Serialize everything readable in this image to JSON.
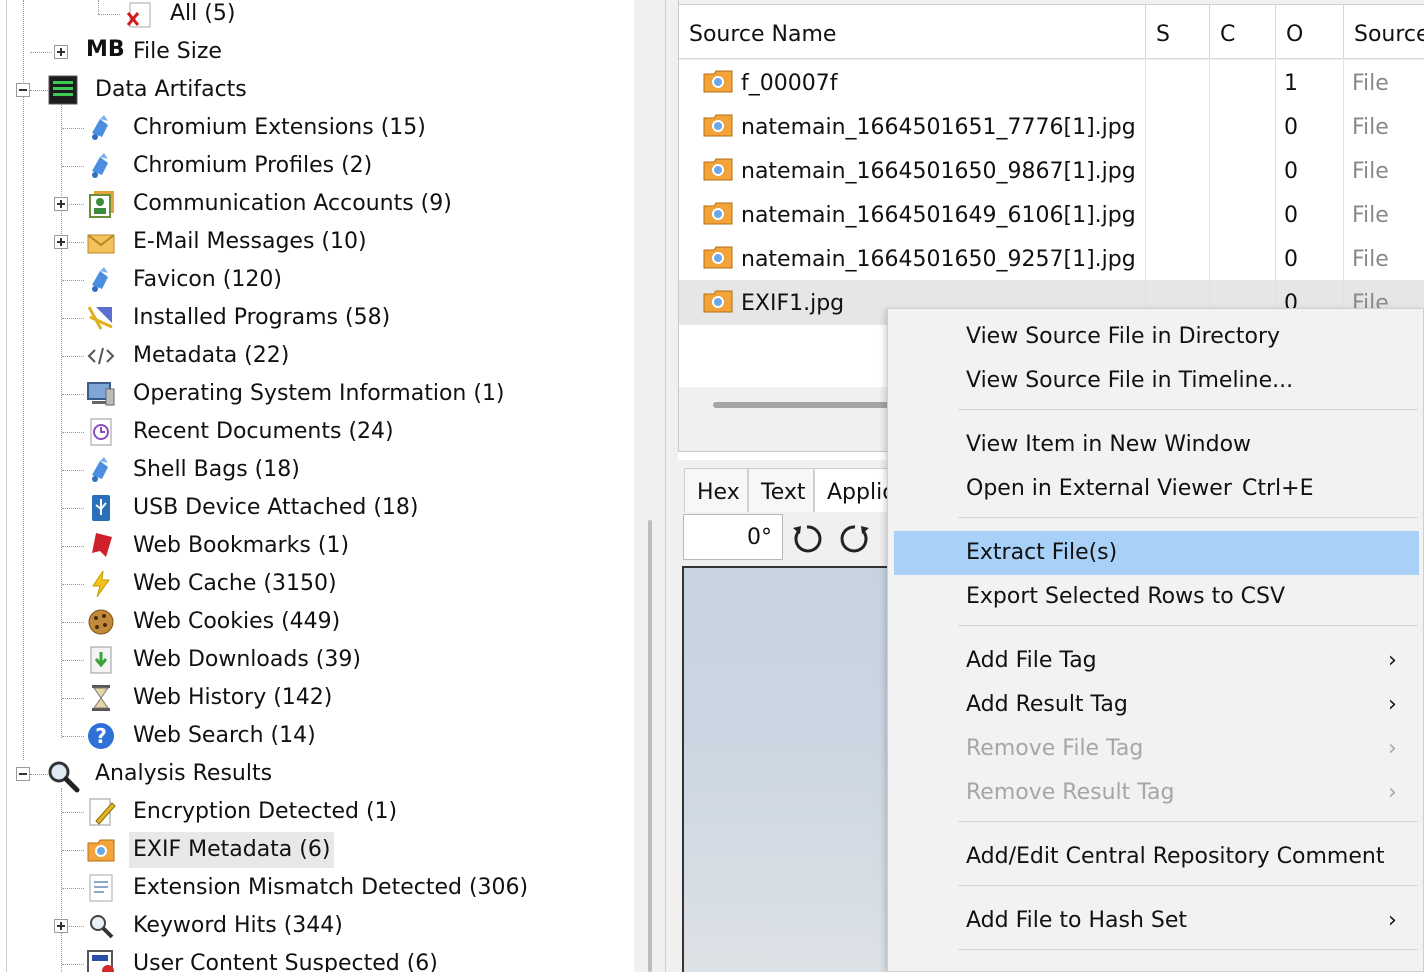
{
  "tree": {
    "top_items": [
      {
        "label": "All (5)"
      },
      {
        "label": "File Size",
        "icon": "MB"
      }
    ],
    "data_artifacts": {
      "label": "Data Artifacts",
      "children": [
        {
          "label": "Chromium Extensions (15)",
          "icon": "puzzle"
        },
        {
          "label": "Chromium Profiles (2)",
          "icon": "puzzle"
        },
        {
          "label": "Communication Accounts (9)",
          "icon": "contacts"
        },
        {
          "label": "E-Mail Messages (10)",
          "icon": "envelope"
        },
        {
          "label": "Favicon (120)",
          "icon": "puzzle"
        },
        {
          "label": "Installed Programs (58)",
          "icon": "installer"
        },
        {
          "label": "Metadata (22)",
          "icon": "code-brackets"
        },
        {
          "label": "Operating System Information (1)",
          "icon": "computer"
        },
        {
          "label": "Recent Documents (24)",
          "icon": "document-clock"
        },
        {
          "label": "Shell Bags (18)",
          "icon": "puzzle"
        },
        {
          "label": "USB Device Attached (18)",
          "icon": "usb"
        },
        {
          "label": "Web Bookmarks (1)",
          "icon": "bookmark"
        },
        {
          "label": "Web Cache (3150)",
          "icon": "lightning"
        },
        {
          "label": "Web Cookies (449)",
          "icon": "cookie"
        },
        {
          "label": "Web Downloads (39)",
          "icon": "download"
        },
        {
          "label": "Web History (142)",
          "icon": "hourglass"
        },
        {
          "label": "Web Search (14)",
          "icon": "question-globe"
        }
      ]
    },
    "analysis_results": {
      "label": "Analysis Results",
      "children": [
        {
          "label": "Encryption Detected (1)",
          "icon": "document-pen"
        },
        {
          "label": "EXIF Metadata (6)",
          "icon": "camera-folder",
          "selected": true
        },
        {
          "label": "Extension Mismatch Detected (306)",
          "icon": "document-lines"
        },
        {
          "label": "Keyword Hits (344)",
          "icon": "magnifier"
        },
        {
          "label": "User Content Suspected (6)",
          "icon": "report"
        }
      ]
    }
  },
  "table": {
    "columns": [
      "Source Name",
      "S",
      "C",
      "O",
      "Source"
    ],
    "rows": [
      {
        "name": "f_00007f",
        "s": "",
        "c": "",
        "o": "1",
        "type": "File"
      },
      {
        "name": "natemain_1664501651_7776[1].jpg",
        "s": "",
        "c": "",
        "o": "0",
        "type": "File"
      },
      {
        "name": "natemain_1664501650_9867[1].jpg",
        "s": "",
        "c": "",
        "o": "0",
        "type": "File"
      },
      {
        "name": "natemain_1664501649_6106[1].jpg",
        "s": "",
        "c": "",
        "o": "0",
        "type": "File"
      },
      {
        "name": "natemain_1664501650_9257[1].jpg",
        "s": "",
        "c": "",
        "o": "0",
        "type": "File"
      },
      {
        "name": "EXIF1.jpg",
        "s": "",
        "c": "",
        "o": "0",
        "type": "File",
        "selected": true
      }
    ]
  },
  "viewer": {
    "tabs": [
      "Hex",
      "Text",
      "Applic"
    ],
    "rotation": "0°"
  },
  "context_menu": {
    "items": [
      {
        "label": "View Source File in Directory"
      },
      {
        "label": "View Source File in Timeline..."
      },
      {
        "label": "View Item in New Window"
      },
      {
        "label": "Open in External Viewer",
        "shortcut": "Ctrl+E"
      },
      {
        "label": "Extract File(s)",
        "highlighted": true
      },
      {
        "label": "Export Selected Rows to CSV"
      },
      {
        "label": "Add File Tag",
        "submenu": true
      },
      {
        "label": "Add Result Tag",
        "submenu": true
      },
      {
        "label": "Remove File Tag",
        "submenu": true,
        "disabled": true
      },
      {
        "label": "Remove Result Tag",
        "submenu": true,
        "disabled": true
      },
      {
        "label": "Add/Edit Central Repository Comment"
      },
      {
        "label": "Add File to Hash Set",
        "submenu": true
      }
    ],
    "submenu_arrow": "›"
  },
  "colors": {
    "selection_highlight": "#a9d1f7",
    "tree_selection": "#e8e8e8",
    "disabled_text": "#a6a6a6"
  }
}
